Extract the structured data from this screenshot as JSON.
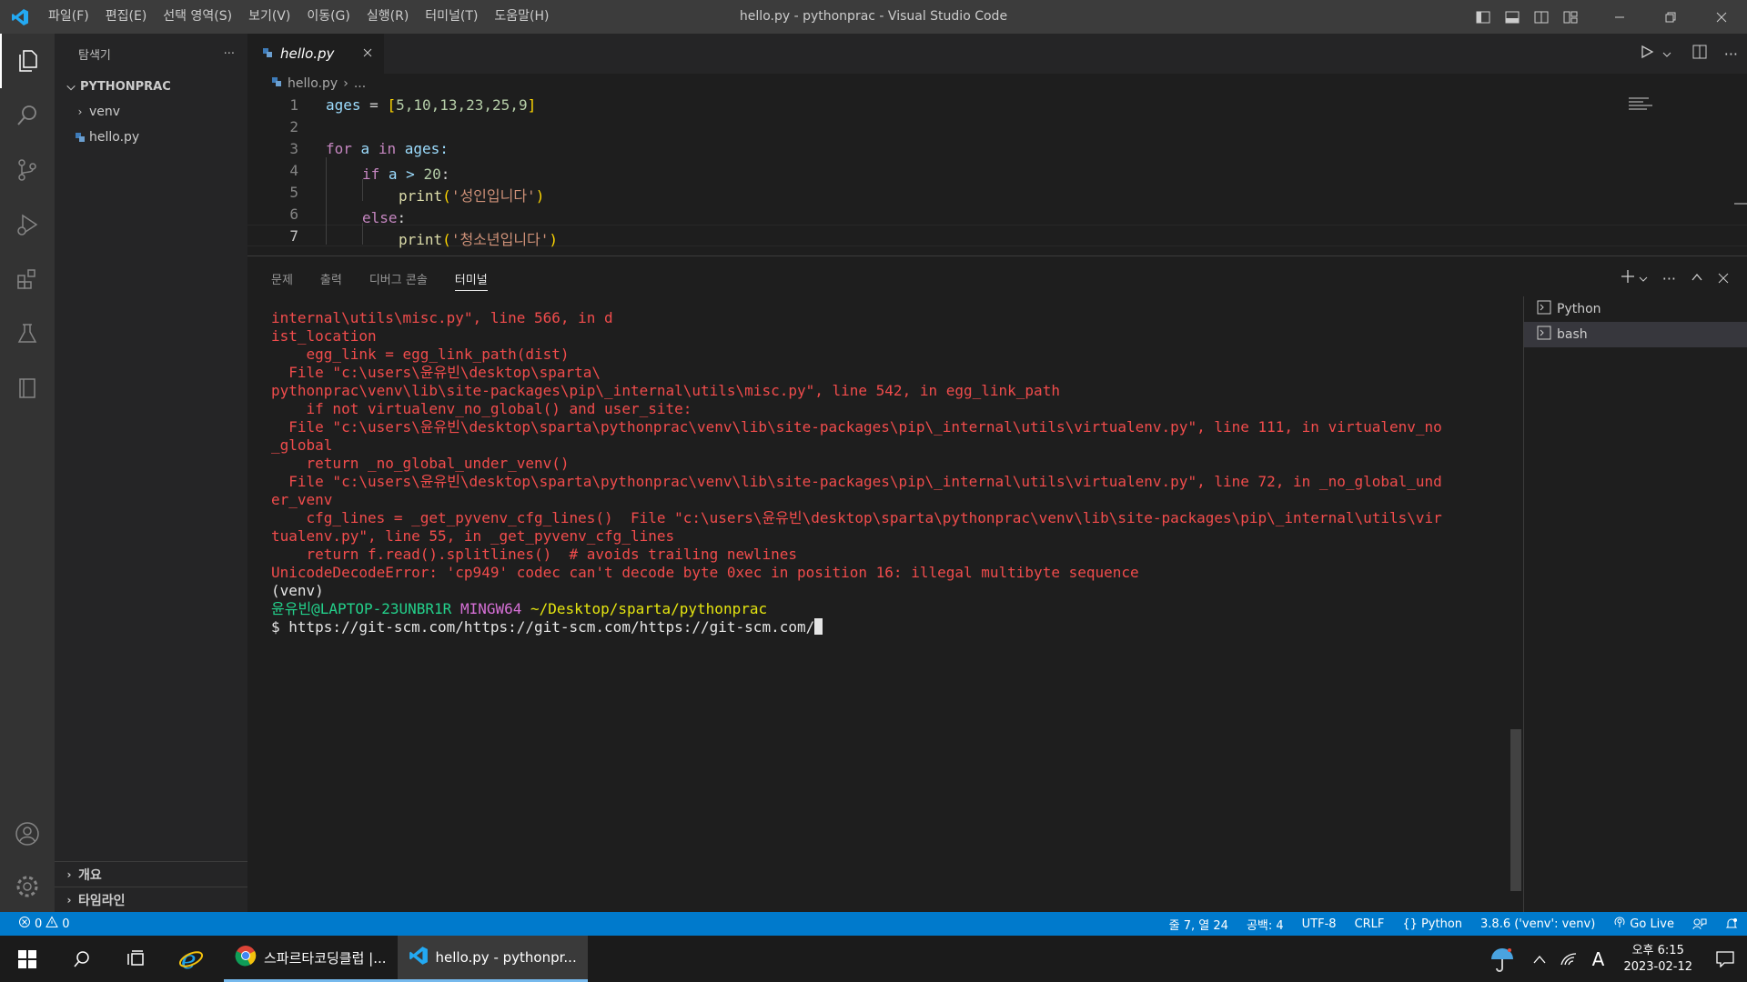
{
  "titlebar": {
    "menu": [
      "파일(F)",
      "편집(E)",
      "선택 영역(S)",
      "보기(V)",
      "이동(G)",
      "실행(R)",
      "터미널(T)",
      "도움말(H)"
    ],
    "title": "hello.py - pythonprac - Visual Studio Code"
  },
  "sidebar": {
    "title": "탐색기",
    "more": "···",
    "root": "PYTHONPRAC",
    "items": [
      "venv",
      "hello.py"
    ],
    "sections": [
      "개요",
      "타임라인"
    ]
  },
  "editor": {
    "tab": "hello.py",
    "breadcrumb_file": "hello.py",
    "breadcrumb_more": "...",
    "line_numbers": [
      "1",
      "2",
      "3",
      "4",
      "5",
      "6",
      "7"
    ],
    "lines": {
      "l1": [
        "ages",
        " = ",
        "[",
        "5,10,13,23,25,9",
        "]"
      ],
      "l3": [
        "for",
        " a ",
        "in",
        " ages:"
      ],
      "l4": [
        "if",
        " a > ",
        "20",
        ":"
      ],
      "l5": [
        "print",
        "(",
        "'성인입니다'",
        ")"
      ],
      "l6": [
        "else",
        ":"
      ],
      "l7": [
        "print",
        "(",
        "'청소년입니다'",
        ")"
      ]
    }
  },
  "panel": {
    "tabs": [
      "문제",
      "출력",
      "디버그 콘솔",
      "터미널"
    ],
    "active_tab": "터미널",
    "terminal_lines": [
      "internal\\utils\\misc.py\", line 566, in d",
      "ist_location",
      "    egg_link = egg_link_path(dist)",
      "  File \"c:\\users\\윤유빈\\desktop\\sparta\\",
      "pythonprac\\venv\\lib\\site-packages\\pip\\_internal\\utils\\misc.py\", line 542, in egg_link_path",
      "    if not virtualenv_no_global() and user_site:",
      "  File \"c:\\users\\윤유빈\\desktop\\sparta\\pythonprac\\venv\\lib\\site-packages\\pip\\_internal\\utils\\virtualenv.py\", line 111, in virtualenv_no",
      "_global",
      "    return _no_global_under_venv()",
      "  File \"c:\\users\\윤유빈\\desktop\\sparta\\pythonprac\\venv\\lib\\site-packages\\pip\\_internal\\utils\\virtualenv.py\", line 72, in _no_global_und",
      "er_venv",
      "    cfg_lines = _get_pyvenv_cfg_lines()  File \"c:\\users\\윤유빈\\desktop\\sparta\\pythonprac\\venv\\lib\\site-packages\\pip\\_internal\\utils\\vir",
      "tualenv.py\", line 55, in _get_pyvenv_cfg_lines",
      "    return f.read().splitlines()  # avoids trailing newlines",
      "UnicodeDecodeError: 'cp949' codec can't decode byte 0xec in position 16: illegal multibyte sequence"
    ],
    "venv_line": "(venv)",
    "prompt_user": "윤유빈@LAPTOP-23UNBR1R",
    "prompt_shell": "MINGW64",
    "prompt_path": "~/Desktop/sparta/pythonprac",
    "command": "$ https://git-scm.com/https://git-scm.com/https://git-scm.com/",
    "terminals": [
      "Python",
      "bash"
    ]
  },
  "statusbar": {
    "errors": "0",
    "warnings": "0",
    "position": "줄 7, 열 24",
    "spaces": "공백: 4",
    "encoding": "UTF-8",
    "eol": "CRLF",
    "language": "Python",
    "interpreter": "3.8.6 ('venv': venv)",
    "golive": "Go Live"
  },
  "taskbar": {
    "chrome": "스파르타코딩클럽 |...",
    "vscode": "hello.py - pythonpr...",
    "ime": "A",
    "time": "오후 6:15",
    "date": "2023-02-12"
  },
  "colors": {
    "accent": "#007acc",
    "activity": "#333333",
    "sidebar": "#252526",
    "editor": "#1e1e1e",
    "error_text": "#f14c4c"
  }
}
